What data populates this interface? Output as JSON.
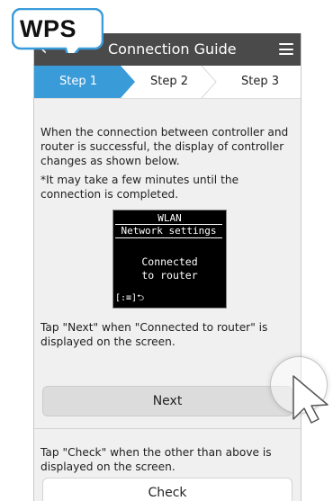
{
  "header": {
    "back_glyph": "‹",
    "title": "Connection Guide"
  },
  "badge": {
    "label": "WPS"
  },
  "steps": [
    {
      "label": "Step 1",
      "active": true
    },
    {
      "label": "Step 2",
      "active": false
    },
    {
      "label": "Step 3",
      "active": false
    }
  ],
  "main": {
    "intro": "When the connection between controller and router is successful, the display of controller changes as shown below.",
    "note": "*It may take a few minutes until the connection is completed.",
    "lcd": {
      "line1": "WLAN",
      "line2": "Network settings",
      "line3": "Connected",
      "line4": "to router",
      "bottom": "[:≡]⮌"
    },
    "next_instruction": "Tap \"Next\" when \"Connected to router\" is displayed on the screen.",
    "next_label": "Next",
    "check_instruction": "Tap \"Check\" when the other than above is displayed on the screen.",
    "check_label": "Check"
  },
  "colors": {
    "accent": "#3a9bd9",
    "titlebar": "#4a4a4a",
    "background": "#f0f0f0"
  }
}
